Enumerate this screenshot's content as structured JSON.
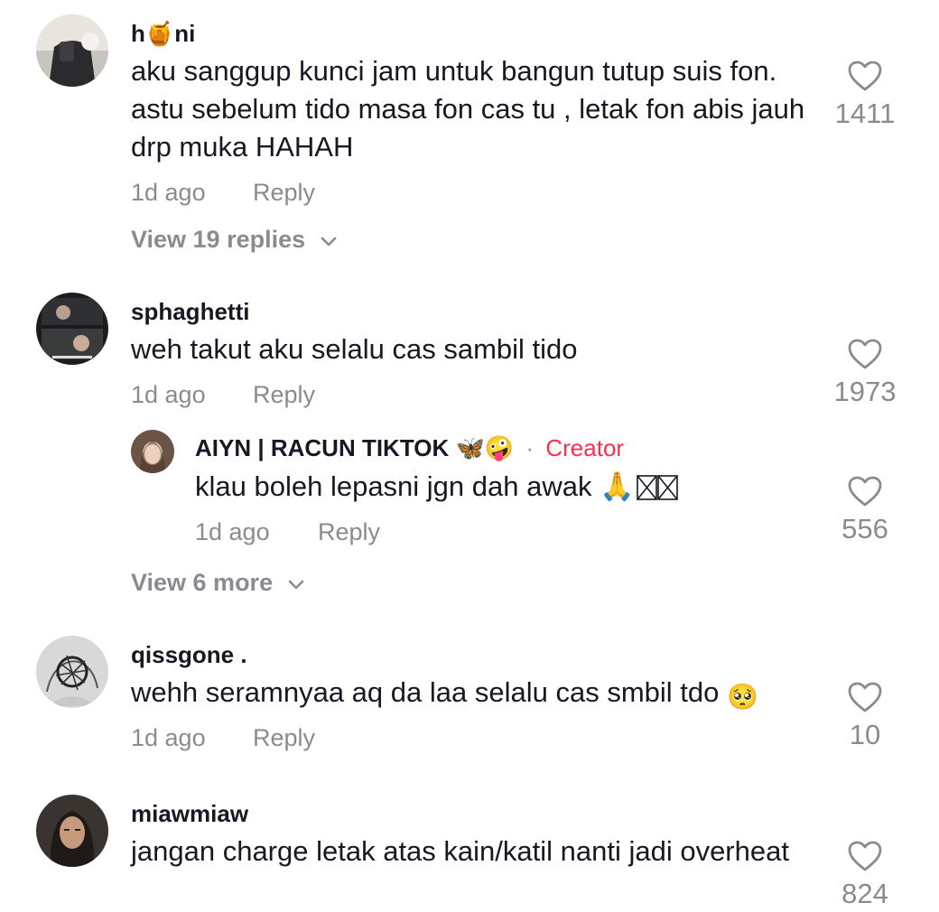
{
  "comments": [
    {
      "username": "h🍯ni",
      "text": "aku sanggup kunci jam untuk bangun tutup suis fon. astu sebelum tido masa fon cas tu , letak fon abis jauh drp muka HAHAH",
      "time": "1d ago",
      "reply_label": "Reply",
      "likes": "1411",
      "view_replies": "View 19 replies"
    },
    {
      "username": "sphaghetti",
      "text": "weh takut aku selalu cas sambil tido",
      "time": "1d ago",
      "reply_label": "Reply",
      "likes": "1973",
      "sub_reply": {
        "username": "AIYN | RACUN TIKTOK 🦋🤪",
        "separator": "·",
        "badge": "Creator",
        "text": "klau boleh lepasni jgn dah awak 🙏",
        "time": "1d ago",
        "reply_label": "Reply",
        "likes": "556"
      },
      "view_more": "View 6 more"
    },
    {
      "username": "qissgone .",
      "text": "wehh seramnyaa aq da laa selalu cas smbil tdo",
      "text_emoji": "🥺",
      "time": "1d ago",
      "reply_label": "Reply",
      "likes": "10"
    },
    {
      "username": "miawmiaw",
      "text": "jangan charge letak atas kain/katil nanti jadi overheat",
      "likes": "824"
    }
  ],
  "colors": {
    "text": "#161823",
    "muted": "#8a8b91",
    "creator": "#fe2c55"
  },
  "icons": {
    "like": "heart-outline-icon",
    "expand": "chevron-down-icon"
  }
}
